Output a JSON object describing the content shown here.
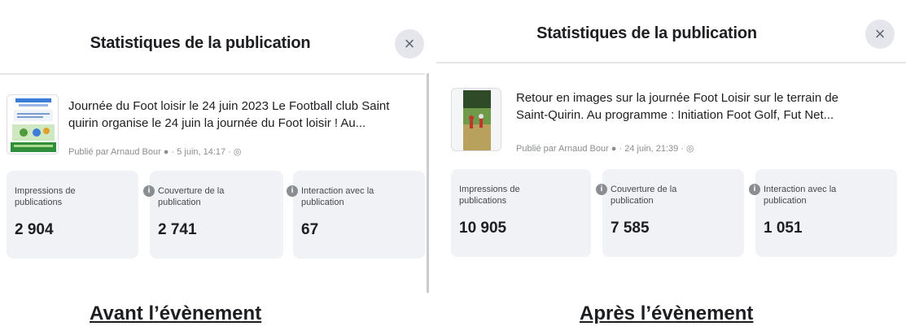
{
  "left": {
    "title": "Statistiques de la publication",
    "close": "×",
    "post_line1": "Journée du Foot loisir le 24 juin 2023 Le Football club Saint",
    "post_line2": "quirin organise le 24 juin la journée du Foot loisir ! Au...",
    "meta": "Publié par Arnaud Bour ● · 5 juin, 14:17 · ◎",
    "cards": [
      {
        "label1": "Impressions de",
        "label2": "publications",
        "value": "2 904"
      },
      {
        "label1": "Couverture de la",
        "label2": "publication",
        "value": "2 741"
      },
      {
        "label1": "Interaction avec la",
        "label2": "publication",
        "value": "67"
      }
    ],
    "caption": "Avant l’évènement"
  },
  "right": {
    "title": "Statistiques de la publication",
    "close": "×",
    "post_line1": "Retour en images sur la journée Foot Loisir sur le terrain de",
    "post_line2": "Saint-Quirin. Au programme : Initiation Foot Golf, Fut Net...",
    "meta": "Publié par Arnaud Bour ● · 24 juin, 21:39 · ◎",
    "cards": [
      {
        "label1": "Impressions de",
        "label2": "publications",
        "value": "10 905"
      },
      {
        "label1": "Couverture de la",
        "label2": "publication",
        "value": "7 585"
      },
      {
        "label1": "Interaction avec la",
        "label2": "publication",
        "value": "1 051"
      }
    ],
    "caption": "Après l’évènement"
  },
  "info_glyph": "i"
}
